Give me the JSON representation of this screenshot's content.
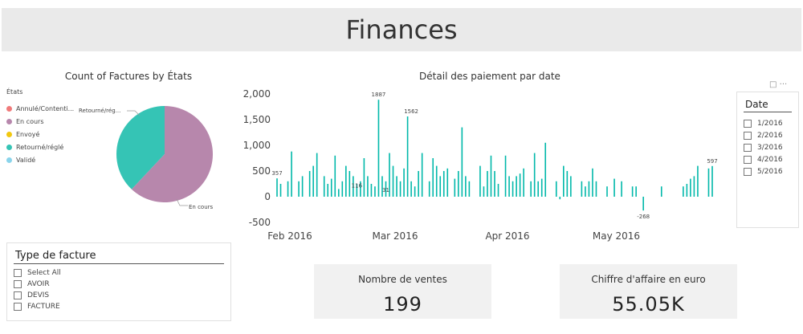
{
  "header": {
    "title": "Finances"
  },
  "pie_chart": {
    "title": "Count of Factures by États",
    "legend_title": "États",
    "legend": [
      {
        "label": "Annulé/Contenti...",
        "color": "#f07a7a"
      },
      {
        "label": "En cours",
        "color": "#b787ac"
      },
      {
        "label": "Envoyé",
        "color": "#f2c80f"
      },
      {
        "label": "Retourné/réglé",
        "color": "#35c4b5"
      },
      {
        "label": "Validé",
        "color": "#8ad4eb"
      }
    ],
    "labels": {
      "retourne": "Retourné/rég...",
      "encours": "En cours"
    }
  },
  "bar_chart": {
    "title": "Détail des paiement par date",
    "focus_icon": "focus-mode-icon",
    "more_icon": "more-options-icon",
    "more_label": "···"
  },
  "date_slicer": {
    "title": "Date",
    "items": [
      "1/2016",
      "2/2016",
      "3/2016",
      "4/2016",
      "5/2016"
    ]
  },
  "type_slicer": {
    "title": "Type de facture",
    "items": [
      "Select All",
      "AVOIR",
      "DEVIS",
      "FACTURE"
    ]
  },
  "cards": [
    {
      "label": "Nombre de ventes",
      "value": "199"
    },
    {
      "label": "Chiffre d'affaire en euro",
      "value": "55.05K"
    }
  ],
  "chart_data": [
    {
      "type": "pie",
      "title": "Count of Factures by États",
      "categories": [
        "Annulé/Contenti...",
        "En cours",
        "Envoyé",
        "Retourné/réglé",
        "Validé"
      ],
      "values": [
        0,
        62,
        0,
        38,
        0
      ],
      "colors": [
        "#f07a7a",
        "#b787ac",
        "#f2c80f",
        "#35c4b5",
        "#8ad4eb"
      ],
      "legend_position": "left"
    },
    {
      "type": "bar",
      "title": "Détail des paiement par date",
      "xlabel": "",
      "ylabel": "",
      "ylim": [
        -500,
        2000
      ],
      "yticks": [
        -500,
        0,
        500,
        1000,
        1500,
        2000
      ],
      "ytick_labels": [
        "-500",
        "0",
        "500",
        "1,000",
        "1,500",
        "2,000"
      ],
      "xlim": [
        "2016-02-01",
        "2016-05-31"
      ],
      "xticks": [
        "2016-02-01",
        "2016-03-01",
        "2016-04-01",
        "2016-05-01"
      ],
      "xtick_labels": [
        "Feb 2016",
        "Mar 2016",
        "Apr 2016",
        "May 2016"
      ],
      "color": "#01b8aa",
      "grid": false,
      "x": [
        "2016-02-01",
        "2016-02-02",
        "2016-02-04",
        "2016-02-05",
        "2016-02-07",
        "2016-02-08",
        "2016-02-10",
        "2016-02-11",
        "2016-02-12",
        "2016-02-14",
        "2016-02-15",
        "2016-02-16",
        "2016-02-17",
        "2016-02-18",
        "2016-02-19",
        "2016-02-20",
        "2016-02-21",
        "2016-02-22",
        "2016-02-23",
        "2016-02-24",
        "2016-02-25",
        "2016-02-26",
        "2016-02-27",
        "2016-02-28",
        "2016-02-29",
        "2016-03-01",
        "2016-03-02",
        "2016-03-03",
        "2016-03-04",
        "2016-03-05",
        "2016-03-06",
        "2016-03-07",
        "2016-03-08",
        "2016-03-09",
        "2016-03-10",
        "2016-03-11",
        "2016-03-12",
        "2016-03-14",
        "2016-03-15",
        "2016-03-16",
        "2016-03-17",
        "2016-03-18",
        "2016-03-19",
        "2016-03-21",
        "2016-03-22",
        "2016-03-23",
        "2016-03-24",
        "2016-03-25",
        "2016-03-28",
        "2016-03-29",
        "2016-03-30",
        "2016-03-31",
        "2016-04-01",
        "2016-04-02",
        "2016-04-04",
        "2016-04-05",
        "2016-04-06",
        "2016-04-07",
        "2016-04-08",
        "2016-04-09",
        "2016-04-11",
        "2016-04-12",
        "2016-04-13",
        "2016-04-14",
        "2016-04-15",
        "2016-04-18",
        "2016-04-19",
        "2016-04-20",
        "2016-04-21",
        "2016-04-22",
        "2016-04-25",
        "2016-04-26",
        "2016-04-27",
        "2016-04-28",
        "2016-04-29",
        "2016-05-02",
        "2016-05-04",
        "2016-05-06",
        "2016-05-09",
        "2016-05-10",
        "2016-05-17",
        "2016-05-23",
        "2016-05-24",
        "2016-05-25",
        "2016-05-26",
        "2016-05-27",
        "2016-05-30",
        "2016-05-31"
      ],
      "values": [
        357,
        250,
        300,
        880,
        300,
        400,
        500,
        600,
        850,
        400,
        250,
        350,
        800,
        150,
        300,
        600,
        500,
        400,
        250,
        300,
        750,
        400,
        250,
        200,
        1887,
        400,
        300,
        850,
        600,
        400,
        300,
        550,
        1562,
        300,
        200,
        500,
        850,
        300,
        750,
        600,
        400,
        500,
        550,
        350,
        500,
        1350,
        400,
        300,
        600,
        200,
        500,
        800,
        500,
        250,
        800,
        400,
        300,
        400,
        450,
        550,
        300,
        850,
        300,
        350,
        1050,
        300,
        -50,
        600,
        500,
        400,
        300,
        200,
        300,
        550,
        300,
        200,
        350,
        300,
        200,
        200,
        200,
        200,
        250,
        350,
        400,
        600,
        550,
        597
      ],
      "annotations": [
        {
          "x": "2016-02-01",
          "value": 357,
          "label": "357"
        },
        {
          "x": "2016-02-29",
          "value": 1887,
          "label": "1887"
        },
        {
          "x": "2016-03-09",
          "value": 1562,
          "label": "1562"
        },
        {
          "x": "2016-05-12",
          "value": -268,
          "label": "-268"
        },
        {
          "x": "2016-05-31",
          "value": 597,
          "label": "597"
        },
        {
          "x": "2016-02-23",
          "value": 116,
          "label": "116"
        },
        {
          "x": "2016-03-02",
          "value": 31,
          "label": "31"
        }
      ]
    }
  ]
}
